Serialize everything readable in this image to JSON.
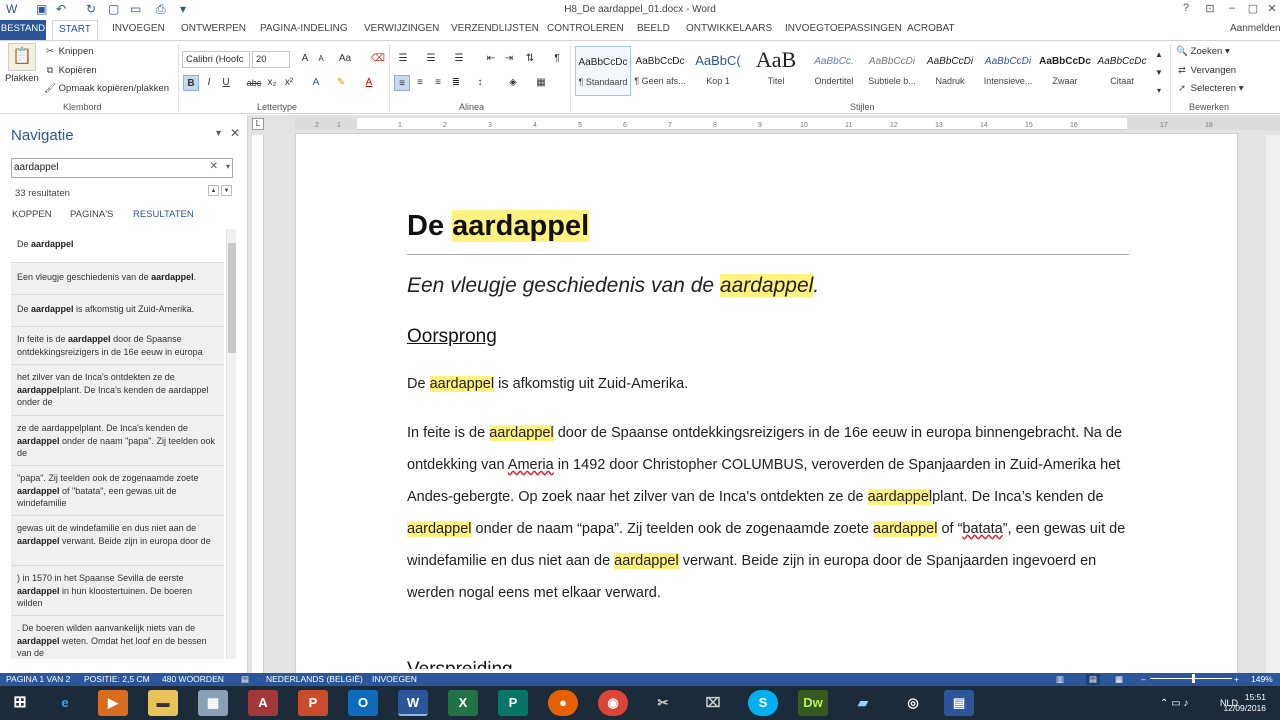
{
  "titlebar": {
    "doc_title": "H8_De aardappel_01.docx - Word",
    "signin": "Aanmelden"
  },
  "tabs": [
    "BESTAND",
    "START",
    "INVOEGEN",
    "ONTWERPEN",
    "PAGINA-INDELING",
    "VERWIJZINGEN",
    "VERZENDLIJSTEN",
    "CONTROLEREN",
    "BEELD",
    "ONTWIKKELAARS",
    "INVOEGTOEPASSINGEN",
    "ACROBAT"
  ],
  "clipboard": {
    "paste": "Plakken",
    "cut": "Knippen",
    "copy": "Kopiëren",
    "format_painter": "Opmaak kopiëren/plakken",
    "label": "Klembord"
  },
  "font": {
    "family": "Calibri (Hoofc",
    "size": "20",
    "label": "Lettertype"
  },
  "paragraph": {
    "label": "Alinea"
  },
  "styles": {
    "label": "Stijlen",
    "items": [
      {
        "preview": "AaBbCcDc",
        "name": "¶ Standaard"
      },
      {
        "preview": "AaBbCcDc",
        "name": "¶ Geen afs..."
      },
      {
        "preview": "AaBbC(",
        "name": "Kop 1"
      },
      {
        "preview": "AaB",
        "name": "Titel"
      },
      {
        "preview": "AaBbCc.",
        "name": "Ondertitel"
      },
      {
        "preview": "AaBbCcDi",
        "name": "Subtiele b..."
      },
      {
        "preview": "AaBbCcDi",
        "name": "Nadruk"
      },
      {
        "preview": "AaBbCcDi",
        "name": "Intensieve..."
      },
      {
        "preview": "AaBbCcDc",
        "name": "Zwaar"
      },
      {
        "preview": "AaBbCcDc",
        "name": "Citaat"
      }
    ]
  },
  "editing": {
    "find": "Zoeken",
    "replace": "Vervangen",
    "select": "Selecteren",
    "label": "Bewerken"
  },
  "navigation": {
    "title": "Navigatie",
    "search_value": "aardappel",
    "count": "33 resultaten",
    "tabs": [
      "KOPPEN",
      "PAGINA'S",
      "RESULTATEN"
    ],
    "results": [
      {
        "pre": "De ",
        "hit": "aardappel",
        "post": ""
      },
      {
        "pre": "Een vleugje geschiedenis van de ",
        "hit": "aardappel",
        "post": "."
      },
      {
        "pre": "De ",
        "hit": "aardappel",
        "post": " is afkomstig uit Zuid-Amerika."
      },
      {
        "pre": "In feite is de ",
        "hit": "aardappel",
        "post": " door de Spaanse ontdekkingsreizigers in de 16e eeuw in europa"
      },
      {
        "pre": "het zilver van de Inca's ontdekten ze de ",
        "hit": "aardappel",
        "post": "plant. De Inca's kenden de aardappel onder de"
      },
      {
        "pre": "ze de aardappelplant. De Inca's kenden de ",
        "hit": "aardappel",
        "post": " onder de naam \"papa\". Zij teelden ook de"
      },
      {
        "pre": "\"papa\". Zij teelden ook de zogenaamde zoete ",
        "hit": "aardappel",
        "post": " of \"batata\", een gewas uit de windefamilie"
      },
      {
        "pre": "gewas uit de windefamilie en dus niet aan de ",
        "hit": "aardappel",
        "post": " verwant. Beide zijn in europa door de"
      },
      {
        "pre": ") in 1570 in het Spaanse Sevilla de eerste ",
        "hit": "aardappel",
        "post": " in hun kloostertuinen. De boeren wilden"
      },
      {
        "pre": ". De boeren wilden aanvankelijk niets van de ",
        "hit": "aardappel",
        "post": " weten. Omdat het loof en de bessen van de"
      }
    ]
  },
  "document": {
    "title_pre": "De ",
    "title_hit": "aardappel",
    "subtitle_pre": "Een vleugje geschiedenis van de ",
    "subtitle_hit": "aardappel",
    "subtitle_post": ".",
    "heading1": "Oorsprong",
    "p1_pre": "De ",
    "p1_hit": "aardappel",
    "p1_post": " is afkomstig uit Zuid-Amerika.",
    "heading2_partial": "Verspreiding"
  },
  "status": {
    "page": "PAGINA 1 VAN 2",
    "position": "POSITIE: 2,5 CM",
    "words": "480 WOORDEN",
    "language": "NEDERLANDS (BELGIË)",
    "mode": "INVOEGEN",
    "zoom": "149%"
  },
  "clock": {
    "time": "15:51",
    "date": "12/09/2016",
    "lang": "NLD"
  }
}
